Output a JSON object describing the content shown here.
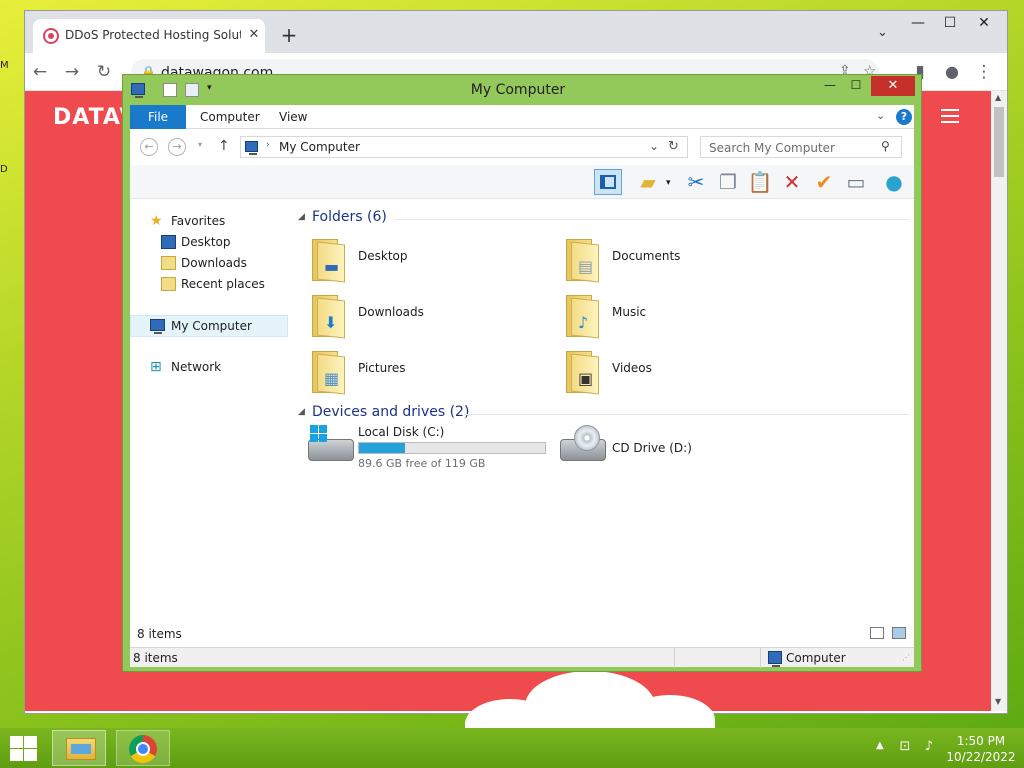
{
  "desktop": {
    "letter_top": "M",
    "letter_mid": "D"
  },
  "browser": {
    "tab_title": "DDoS Protected Hosting Solutio",
    "tab_close": "✕",
    "new_tab": "+",
    "tab_menu": "⌄",
    "url": "datawagon.com",
    "site_logo": "DATAV",
    "win_min": "—",
    "win_max": "☐",
    "win_close": "✕"
  },
  "explorer": {
    "title": "My Computer",
    "window_min": "—",
    "window_max": "☐",
    "window_close": "✕",
    "ribbon": {
      "file": "File",
      "computer": "Computer",
      "view": "View",
      "help": "?"
    },
    "address": "My Computer",
    "search_placeholder": "Search My Computer",
    "nav": {
      "favorites": "Favorites",
      "desktop": "Desktop",
      "downloads": "Downloads",
      "recent": "Recent places",
      "my_computer": "My Computer",
      "network": "Network"
    },
    "folders_header": "Folders (6)",
    "folders": [
      {
        "label": "Desktop",
        "icon": "desktop-folder-icon"
      },
      {
        "label": "Documents",
        "icon": "documents-folder-icon"
      },
      {
        "label": "Downloads",
        "icon": "downloads-folder-icon"
      },
      {
        "label": "Music",
        "icon": "music-folder-icon"
      },
      {
        "label": "Pictures",
        "icon": "pictures-folder-icon"
      },
      {
        "label": "Videos",
        "icon": "videos-folder-icon"
      }
    ],
    "drives_header": "Devices and drives (2)",
    "drives": [
      {
        "label": "Local Disk (C:)",
        "free": "89.6 GB free of 119 GB",
        "used_fraction": 0.247
      },
      {
        "label": "CD Drive (D:)"
      }
    ],
    "item_count": "8 items",
    "status_count": "8 items",
    "status_location": "Computer"
  },
  "taskbar": {
    "time": "1:50 PM",
    "date": "10/22/2022",
    "tray_up": "▲"
  },
  "colors": {
    "desktop_green": "#8fc41e",
    "explorer_frame": "#93c95b",
    "ribbon_file": "#1979ca",
    "site_red": "#ef4a4d",
    "disk_bar": "#26a0da"
  }
}
